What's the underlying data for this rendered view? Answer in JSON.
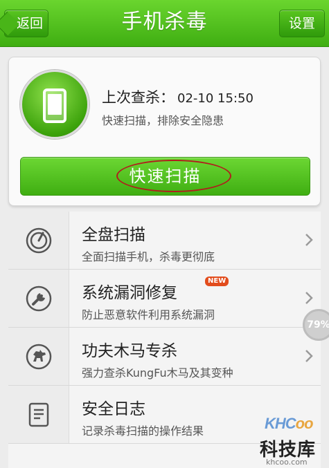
{
  "header": {
    "back_label": "返回",
    "title": "手机杀毒",
    "settings_label": "设置"
  },
  "summary": {
    "last_scan_label": "上次查杀：",
    "last_scan_time": "02-10 15:50",
    "subtitle": "快速扫描，排除安全隐患",
    "quick_scan_label": "快速扫描"
  },
  "list": {
    "items": [
      {
        "title": "全盘扫描",
        "desc": "全面扫描手机，杀毒更彻底",
        "icon": "full-scan-icon"
      },
      {
        "title": "系统漏洞修复",
        "desc": "防止恶意软件利用系统漏洞",
        "icon": "wrench-icon",
        "badge": "NEW"
      },
      {
        "title": "功夫木马专杀",
        "desc": "强力查杀KungFu木马及其变种",
        "icon": "horse-icon"
      },
      {
        "title": "安全日志",
        "desc": "记录杀毒扫描的操作结果",
        "icon": "log-icon"
      }
    ]
  },
  "floating_percent": "79%",
  "watermark": {
    "logo_a": "KHC",
    "logo_b": "oo",
    "name": "科技库",
    "url": "khcoo.com"
  },
  "colors": {
    "accent_green": "#3fae12",
    "annotation_red": "#b11d1d",
    "badge_orange": "#e24c1c"
  }
}
